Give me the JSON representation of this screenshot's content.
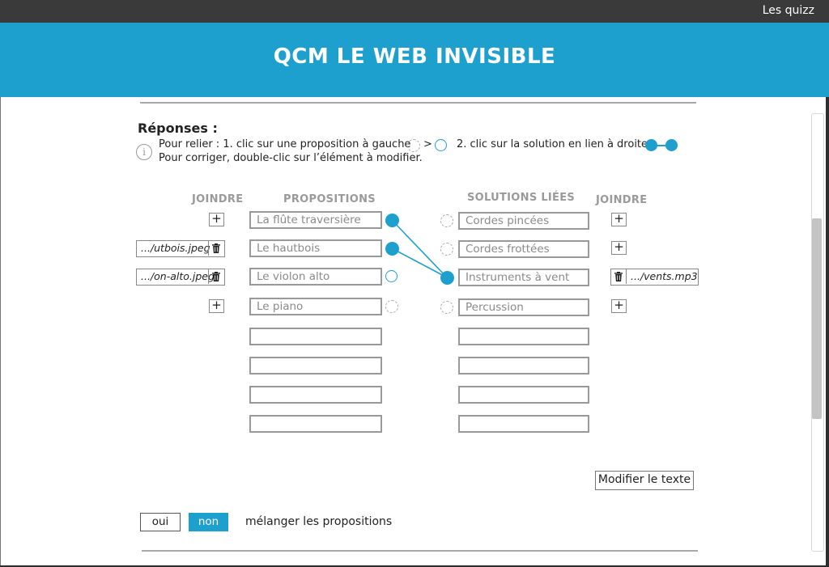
{
  "topbar": {
    "link": "Les quizz"
  },
  "header": {
    "title": "QCM LE WEB INVISIBLE"
  },
  "responses": {
    "title": "Réponses :",
    "instruction_line1_a": "Pour relier : 1. clic sur une proposition à gauche",
    "instruction_gt": ">",
    "instruction_line1_b": "2. clic sur la solution en lien à droite",
    "instruction_line2": "Pour corriger, double-clic sur l’élément à modifier."
  },
  "columns": {
    "join_left": "JOINDRE",
    "propositions": "PROPOSITIONS",
    "solutions": "SOLUTIONS LIÉES",
    "join_right": "JOINDRE"
  },
  "propositions": [
    {
      "text": "La flûte traversière",
      "attachment": "",
      "state": "linked"
    },
    {
      "text": "Le hautbois",
      "attachment": ".../utbois.jpeg",
      "state": "linked"
    },
    {
      "text": "Le violon alto",
      "attachment": ".../on-alto.jpeg",
      "state": "selected"
    },
    {
      "text": "Le piano",
      "attachment": "",
      "state": "empty"
    },
    {
      "text": "",
      "attachment": "",
      "state": "none"
    },
    {
      "text": "",
      "attachment": "",
      "state": "none"
    },
    {
      "text": "",
      "attachment": "",
      "state": "none"
    },
    {
      "text": "",
      "attachment": "",
      "state": "none"
    }
  ],
  "solutions": [
    {
      "text": "Cordes pincées",
      "attachment": "",
      "state": "empty"
    },
    {
      "text": "Cordes frottées",
      "attachment": "",
      "state": "empty"
    },
    {
      "text": "Instruments à vent",
      "attachment": ".../vents.mp3",
      "state": "linked"
    },
    {
      "text": "Percussion",
      "attachment": "",
      "state": "empty"
    },
    {
      "text": "",
      "attachment": "",
      "state": "none"
    },
    {
      "text": "",
      "attachment": "",
      "state": "none"
    },
    {
      "text": "",
      "attachment": "",
      "state": "none"
    },
    {
      "text": "",
      "attachment": "",
      "state": "none"
    }
  ],
  "links": [
    [
      0,
      2
    ],
    [
      1,
      2
    ]
  ],
  "buttons": {
    "modify_text": "Modifier le texte",
    "yes": "oui",
    "no": "non",
    "shuffle_label": "mélanger les propositions"
  },
  "colors": {
    "accent": "#1ea0cf",
    "topbar": "#3a3a3a"
  },
  "icons": {
    "add": "plus-icon",
    "delete": "trash-icon",
    "info": "info-icon"
  }
}
